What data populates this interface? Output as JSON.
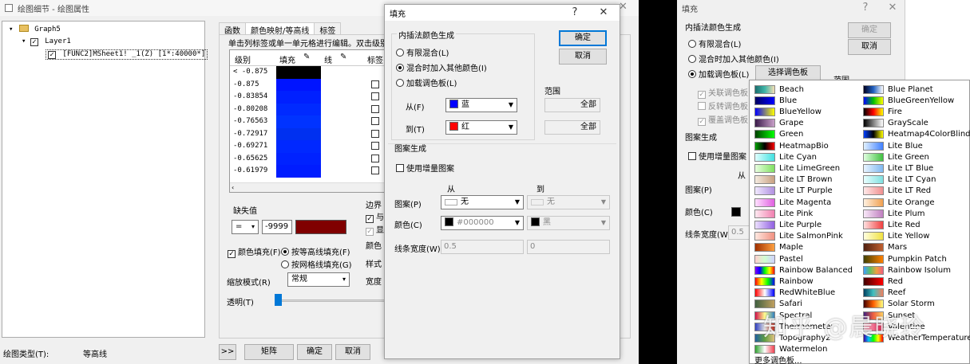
{
  "main_window": {
    "title": "绘图细节 - 绘图属性",
    "tree": [
      {
        "label": "Graph5"
      },
      {
        "label": "Layer1"
      },
      {
        "label": "[FUNC2]MSheet1! _1(Z) [1*:40000*]"
      }
    ],
    "tabs": [
      "函数",
      "颜色映射/等高线",
      "标签"
    ],
    "hint": "单击列标签或单一单元格进行编辑。双击级别标",
    "grid_headers": {
      "level": "级别",
      "fill": "填充",
      "line": "线",
      "label": "标签"
    },
    "levels": [
      "< -0.875",
      "-0.875",
      "-0.83854",
      "-0.80208",
      "-0.76563",
      "-0.72917",
      "-0.69271",
      "-0.65625",
      "-0.61979"
    ],
    "fill_colors": [
      "#000000",
      "#0014ff",
      "#0020ff",
      "#002aff",
      "#0033ff",
      "#0030f0",
      "#0028ff",
      "#0022ff",
      "#001cff"
    ],
    "missing": {
      "label": "缺失值",
      "op": "=",
      "value": "-9999"
    },
    "border": {
      "label": "边界",
      "cb1": "与",
      "cb2": "显"
    },
    "extra_labels": [
      "颜色",
      "样式",
      "宽度"
    ],
    "color_fill": {
      "check_label": "颜色填充(F)",
      "radio1": "按等高线填充(F)",
      "radio2": "按网格线填充(G)"
    },
    "scale_mode": {
      "label": "缩放模式(R)",
      "value": "常规"
    },
    "transparency": {
      "label": "透明(T)"
    },
    "footer": {
      "type_label": "绘图类型(T):",
      "type_value": "等高线",
      "expand": ">>",
      "matrix": "矩阵",
      "ok": "确定",
      "cancel": "取消"
    }
  },
  "fill_dialog": {
    "title": "填充",
    "help": "?",
    "close": "✕",
    "ok": "确定",
    "cancel": "取消",
    "interp": {
      "label": "内插法颜色生成",
      "r1": "有限混合(L)",
      "r2": "混合时加入其他颜色(I)",
      "r3": "加载调色板(L)",
      "from_label": "从(F)",
      "from_value": "蓝",
      "from_color": "#0000ff",
      "to_label": "到(T)",
      "to_value": "红",
      "to_color": "#ff0000"
    },
    "range": {
      "label": "范围",
      "all1": "全部",
      "all2": "全部"
    },
    "pattern": {
      "label": "图案生成",
      "use_inc": "使用增量图案",
      "from_h": "从",
      "to_h": "到",
      "pattern_label": "图案(P)",
      "pattern_from": "无",
      "pattern_to": "无",
      "color_label": "颜色(C)",
      "color_from": "#000000",
      "color_to": "黑",
      "width_label": "线条宽度(W)",
      "width_from": "0.5",
      "width_to": "0"
    }
  },
  "right_dialog": {
    "title": "填充",
    "help": "?",
    "close": "✕",
    "ok": "确定",
    "cancel": "取消",
    "interp_label": "内插法颜色生成",
    "r1": "有限混合(L)",
    "r2": "混合时加入其他颜色(I)",
    "r3": "加载调色板(L)",
    "select_palette": "选择调色板",
    "range_label": "范围",
    "chk_linked": "关联调色板",
    "chk_reverse": "反转调色板",
    "chk_overlay": "覆盖调色板",
    "pattern_label": "图案生成",
    "use_inc": "使用增量图案",
    "from_h": "从",
    "pattern_lbl": "图案(P)",
    "color_lbl": "颜色(C)",
    "width_lbl": "线条宽度(W)",
    "width_val": "0.5"
  },
  "palettes_left": [
    {
      "name": "Beach",
      "c": "linear-gradient(90deg,#1a6e6e,#3fb5a8,#f5deb3)"
    },
    {
      "name": "Blue",
      "c": "linear-gradient(90deg,#000060,#0000ff)"
    },
    {
      "name": "BlueYellow",
      "c": "linear-gradient(90deg,#0000ff,#ffff00)"
    },
    {
      "name": "Grape",
      "c": "linear-gradient(90deg,#3a1a4a,#c8a0c8)"
    },
    {
      "name": "Green",
      "c": "linear-gradient(90deg,#004000,#00ff00)"
    },
    {
      "name": "HeatmapBio",
      "c": "linear-gradient(90deg,#00a000,#000,#ff0000)"
    },
    {
      "name": "Lite Cyan",
      "c": "linear-gradient(90deg,#e0ffff,#40e0e0)"
    },
    {
      "name": "Lite LimeGreen",
      "c": "linear-gradient(90deg,#e8ffe0,#80e060)"
    },
    {
      "name": "Lite LT Brown",
      "c": "linear-gradient(90deg,#f5ebe0,#c8a080)"
    },
    {
      "name": "Lite LT Purple",
      "c": "linear-gradient(90deg,#f0e8ff,#b090e0)"
    },
    {
      "name": "Lite Magenta",
      "c": "linear-gradient(90deg,#ffe0ff,#e060e0)"
    },
    {
      "name": "Lite Pink",
      "c": "linear-gradient(90deg,#ffe8f0,#f080b0)"
    },
    {
      "name": "Lite Purple",
      "c": "linear-gradient(90deg,#ece0ff,#9060e0)"
    },
    {
      "name": "Lite SalmonPink",
      "c": "linear-gradient(90deg,#ffe8e0,#f09080)"
    },
    {
      "name": "Maple",
      "c": "linear-gradient(90deg,#a03000,#ffa040)"
    },
    {
      "name": "Pastel",
      "c": "linear-gradient(90deg,#ffd0d0,#d0ffd0,#d0d0ff)"
    },
    {
      "name": "Rainbow Balanced",
      "c": "linear-gradient(90deg,#8000ff,#0000ff,#00ff00,#ffff00,#ff0000)"
    },
    {
      "name": "Rainbow",
      "c": "linear-gradient(90deg,#ff0000,#ffff00,#00ff00,#0000ff)"
    },
    {
      "name": "RedWhiteBlue",
      "c": "linear-gradient(90deg,#ff0000,#ffffff,#0000ff)"
    },
    {
      "name": "Safari",
      "c": "linear-gradient(90deg,#406040,#c0a060)"
    },
    {
      "name": "Spectral",
      "c": "linear-gradient(90deg,#d0104a,#ffff90,#3080c0)"
    },
    {
      "name": "Thermometer",
      "c": "linear-gradient(90deg,#3040c0,#e0e0e0,#c03020)"
    },
    {
      "name": "Topography2",
      "c": "linear-gradient(90deg,#2060a0,#60a040,#e0c080)"
    },
    {
      "name": "Watermelon",
      "c": "linear-gradient(90deg,#30a030,#ffffff,#f04050)"
    }
  ],
  "palettes_right": [
    {
      "name": "Blue Planet",
      "c": "linear-gradient(90deg,#000020,#2060c0,#ffffff)"
    },
    {
      "name": "BlueGreenYellow",
      "c": "linear-gradient(90deg,#0000ff,#00c000,#ffff00)"
    },
    {
      "name": "Fire",
      "c": "linear-gradient(90deg,#000000,#ff0000,#ffff00)"
    },
    {
      "name": "GrayScale",
      "c": "linear-gradient(90deg,#000000,#ffffff)"
    },
    {
      "name": "Heatmap4ColorBlind",
      "c": "linear-gradient(90deg,#0040ff,#000,#ffff00)"
    },
    {
      "name": "Lite Blue",
      "c": "linear-gradient(90deg,#e0f0ff,#4080ff)"
    },
    {
      "name": "Lite Green",
      "c": "linear-gradient(90deg,#e0ffe0,#40c040)"
    },
    {
      "name": "Lite LT Blue",
      "c": "linear-gradient(90deg,#e8f4ff,#80b8f0)"
    },
    {
      "name": "Lite LT Cyan",
      "c": "linear-gradient(90deg,#e8ffff,#80e0e0)"
    },
    {
      "name": "Lite LT Red",
      "c": "linear-gradient(90deg,#ffe8e8,#f09090)"
    },
    {
      "name": "Lite Orange",
      "c": "linear-gradient(90deg,#fff0e0,#f0a050)"
    },
    {
      "name": "Lite Plum",
      "c": "linear-gradient(90deg,#f8e8f8,#c080c0)"
    },
    {
      "name": "Lite Red",
      "c": "linear-gradient(90deg,#ffe0e0,#f04040)"
    },
    {
      "name": "Lite Yellow",
      "c": "linear-gradient(90deg,#ffffe0,#f0e040)"
    },
    {
      "name": "Mars",
      "c": "linear-gradient(90deg,#502010,#c06030)"
    },
    {
      "name": "Pumpkin Patch",
      "c": "linear-gradient(90deg,#404000,#ff8000)"
    },
    {
      "name": "Rainbow Isolum",
      "c": "linear-gradient(90deg,#40a0ff,#60c060,#f0a040,#f06080)"
    },
    {
      "name": "Red",
      "c": "linear-gradient(90deg,#400000,#ff0000)"
    },
    {
      "name": "Reef",
      "c": "linear-gradient(90deg,#004060,#40c0c0,#f08060)"
    },
    {
      "name": "Solar Storm",
      "c": "linear-gradient(90deg,#400000,#ff6000,#ffff80)"
    },
    {
      "name": "Sunset",
      "c": "linear-gradient(90deg,#402080,#f06040,#ffd060)"
    },
    {
      "name": "Valentine",
      "c": "linear-gradient(90deg,#ffc0d0,#e02050)"
    },
    {
      "name": "WeatherTemperature",
      "c": "linear-gradient(90deg,#4000a0,#00c0ff,#00ff00,#ffff00,#ff0000)"
    }
  ],
  "more_palettes": "更多调色板...",
  "watermark": "知乎 @晨晓玲",
  "colors": {
    "accent": "#0078d7",
    "window_bg": "#f0f0f0"
  }
}
